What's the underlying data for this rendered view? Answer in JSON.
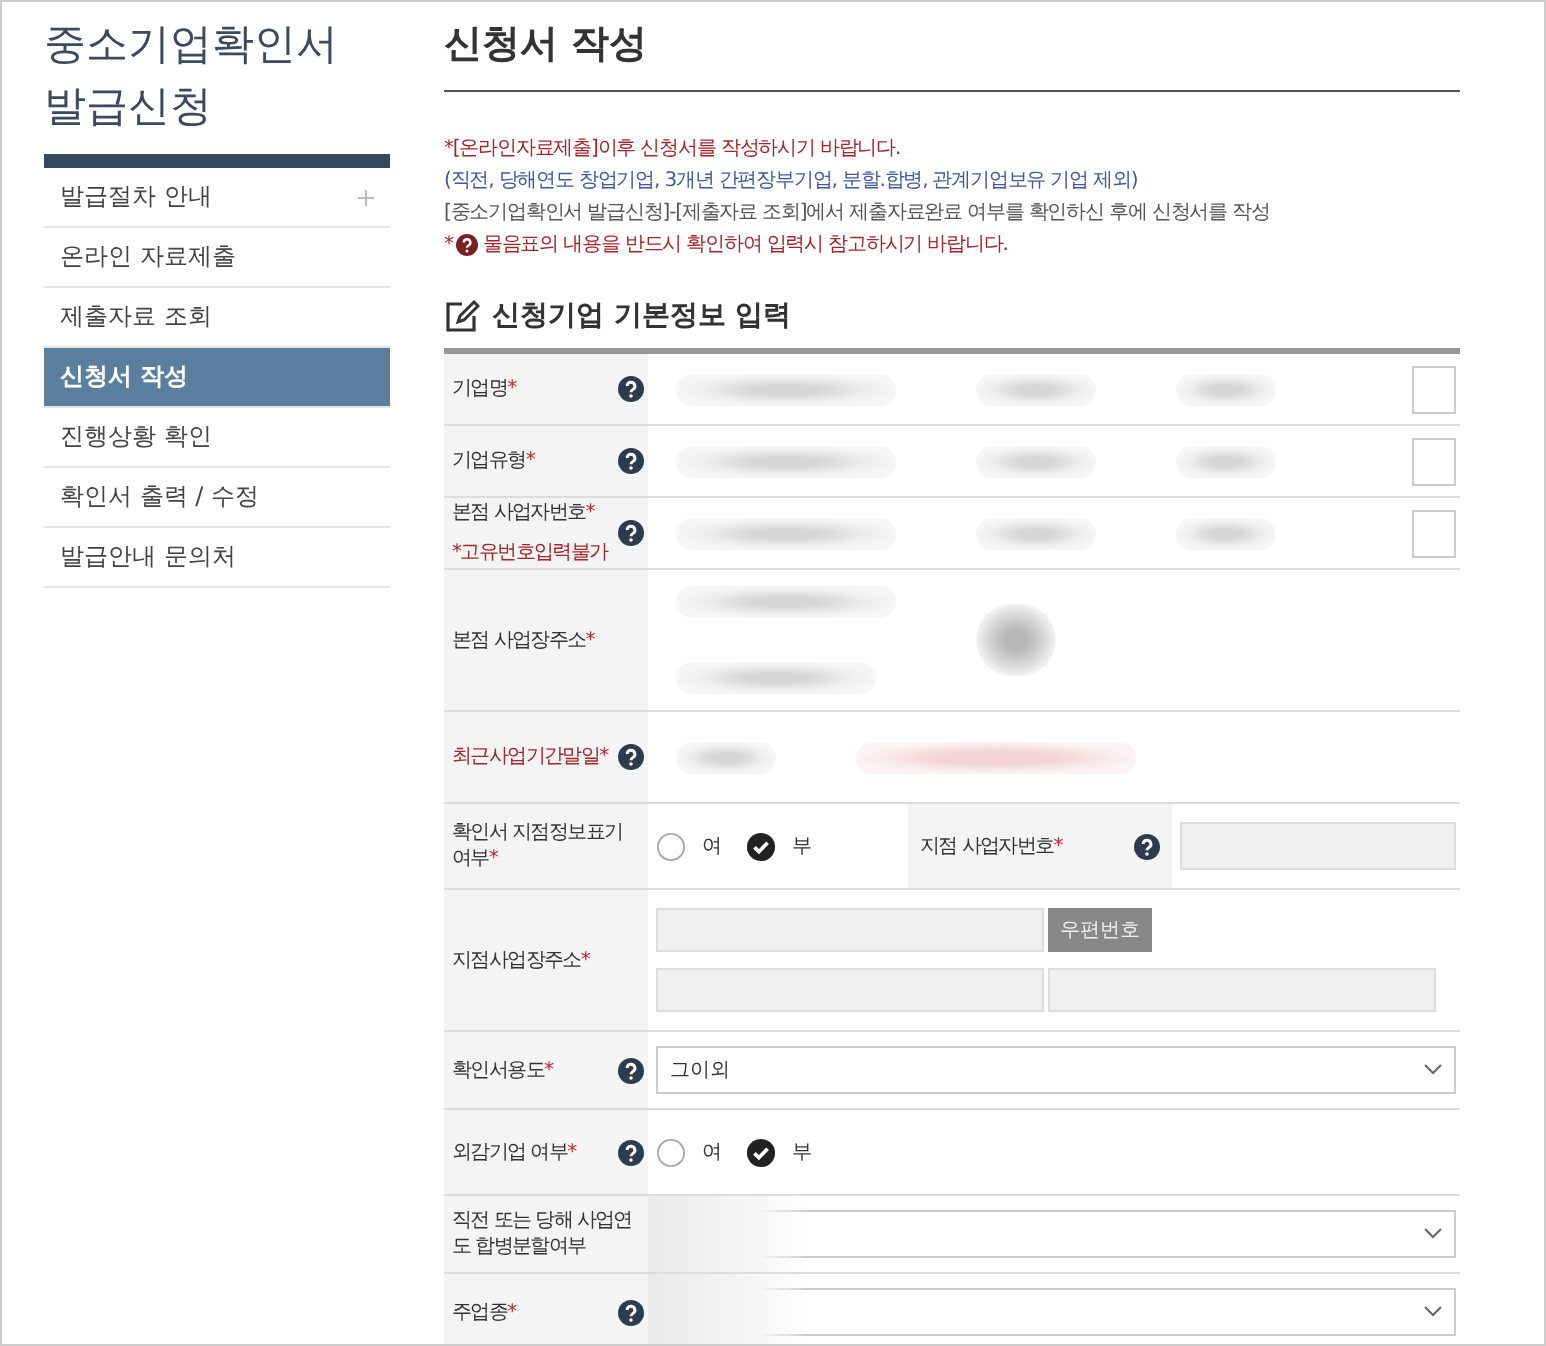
{
  "sidebar": {
    "title_lines": [
      "중소기업확인서",
      "발급신청"
    ],
    "items": [
      {
        "label": "발급절차 안내",
        "selected": false,
        "expandable": true
      },
      {
        "label": "온라인 자료제출",
        "selected": false,
        "expandable": false
      },
      {
        "label": "제출자료 조회",
        "selected": false,
        "expandable": false
      },
      {
        "label": "신청서 작성",
        "selected": true,
        "expandable": false
      },
      {
        "label": "진행상황 확인",
        "selected": false,
        "expandable": false
      },
      {
        "label": "확인서 출력 / 수정",
        "selected": false,
        "expandable": false
      },
      {
        "label": "발급안내 문의처",
        "selected": false,
        "expandable": false
      }
    ]
  },
  "page_title": "신청서 작성",
  "notices": [
    {
      "kind": "warning",
      "text": "*[온라인자료제출]이후 신청서를 작성하시기 바랍니다."
    },
    {
      "kind": "info",
      "text": "(직전, 당해연도 창업기업, 3개년 간편장부기업, 분할.합병, 관계기업보유 기업 제외)"
    },
    {
      "kind": "plain",
      "text": "[중소기업확인서 발급신청]-[제출자료 조회]에서 제출자료완료 여부를 확인하신 후에 신청서를 작성"
    },
    {
      "kind": "help",
      "prefix": "*",
      "text": "물음표의 내용을 반드시 확인하여 입력시 참고하시기 바랍니다."
    }
  ],
  "section_title": "신청기업 기본정보 입력",
  "rows": [
    {
      "kind": "blurred",
      "label": "기업명",
      "required_mark": "*",
      "help": true,
      "emphasis": false
    },
    {
      "kind": "blurred",
      "label": "기업유형",
      "required_mark": "*",
      "help": true,
      "emphasis": false
    },
    {
      "kind": "blurred",
      "label": "본점 사업자번호",
      "required_mark": "*",
      "help": true,
      "emphasis": false,
      "note": "*고유번호입력불가"
    },
    {
      "kind": "blurred_tall",
      "label": "본점 사업장주소",
      "required_mark": "*",
      "help": false,
      "emphasis": false
    },
    {
      "kind": "blurred_date",
      "label": "최근사업기간말일",
      "required_mark": "*",
      "help": true,
      "emphasis": true
    },
    {
      "kind": "radio",
      "label": "확인서 지점정보표기 여부",
      "required_mark": "*",
      "help": false,
      "emphasis": false,
      "options": [
        {
          "label": "여",
          "selected": false
        },
        {
          "label": "부",
          "selected": true
        }
      ],
      "side": {
        "label": "지점 사업자번호",
        "required_mark": "*",
        "help": true,
        "disabled": true
      }
    },
    {
      "kind": "address",
      "label": "지점사업장주소",
      "required_mark": "*",
      "help": false,
      "emphasis": false,
      "button": "우편번호"
    },
    {
      "kind": "select",
      "label": "확인서용도",
      "required_mark": "*",
      "help": true,
      "emphasis": false,
      "value": "그이외"
    },
    {
      "kind": "radio",
      "label": "외감기업 여부",
      "required_mark": "*",
      "help": true,
      "emphasis": false,
      "options": [
        {
          "label": "여",
          "selected": false
        },
        {
          "label": "부",
          "selected": true
        }
      ]
    },
    {
      "kind": "select_blurred",
      "label": "직전 또는 당해 사업연도 합병분할여부",
      "help": false,
      "emphasis": false
    },
    {
      "kind": "select_blurred",
      "label": "주업종",
      "required_mark": "*",
      "help": true,
      "emphasis": false
    }
  ]
}
